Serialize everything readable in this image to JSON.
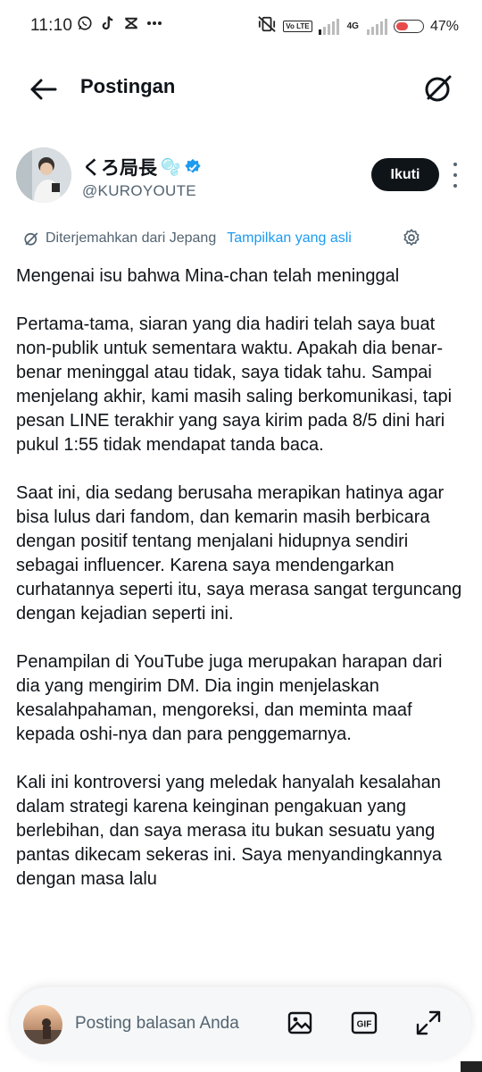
{
  "status_bar": {
    "time": "11:10",
    "apps": [
      "whatsapp-icon",
      "tiktok-icon",
      "capcut-icon",
      "more-dots-icon"
    ],
    "net_badge_1": "Vo LTE",
    "net_badge_2": "4G",
    "battery_percent": "47%",
    "battery_level": 0.47,
    "battery_color": "#e84a4a"
  },
  "header": {
    "title": "Postingan",
    "back_icon": "arrow-left-icon",
    "grok_icon": "grok-icon"
  },
  "post": {
    "author_name": "くろ局長",
    "author_emoji": "🫧",
    "verified_icon": "verified-badge-icon",
    "handle": "@KUROYOUTE",
    "follow_label": "Ikuti",
    "translation_label": "Diterjemahkan dari Jepang",
    "show_original_label": "Tampilkan yang asli",
    "paragraphs": [
      "Mengenai isu bahwa Mina-chan telah meninggal",
      "Pertama-tama, siaran yang dia hadiri telah saya buat non-publik untuk sementara waktu. Apakah dia benar-benar meninggal atau tidak, saya tidak tahu. Sampai menjelang akhir, kami masih saling berkomunikasi, tapi pesan LINE terakhir yang saya kirim pada 8/5 dini hari pukul 1:55 tidak mendapat tanda baca.",
      "Saat ini, dia sedang berusaha merapikan hatinya agar bisa lulus dari fandom, dan kemarin masih berbicara dengan positif tentang menjalani hidupnya sendiri sebagai influencer. Karena saya mendengarkan curhatannya seperti itu, saya merasa sangat terguncang dengan kejadian seperti ini.",
      "Penampilan di YouTube juga merupakan harapan dari dia yang mengirim DM. Dia ingin menjelaskan kesalahpahaman, mengoreksi, dan meminta maaf kepada oshi-nya dan para penggemarnya.",
      "Kali ini kontroversi yang meledak hanyalah kesalahan dalam strategi karena keinginan pengakuan yang berlebihan, dan saya merasa itu bukan sesuatu yang pantas dikecam sekeras ini. Saya menyandingkannya dengan masa lalu"
    ]
  },
  "reply_bar": {
    "placeholder": "Posting balasan Anda",
    "image_icon": "image-icon",
    "gif_label": "GIF",
    "expand_icon": "expand-icon"
  },
  "colors": {
    "text": "#0f1419",
    "muted": "#536471",
    "link": "#1d9bf0"
  }
}
